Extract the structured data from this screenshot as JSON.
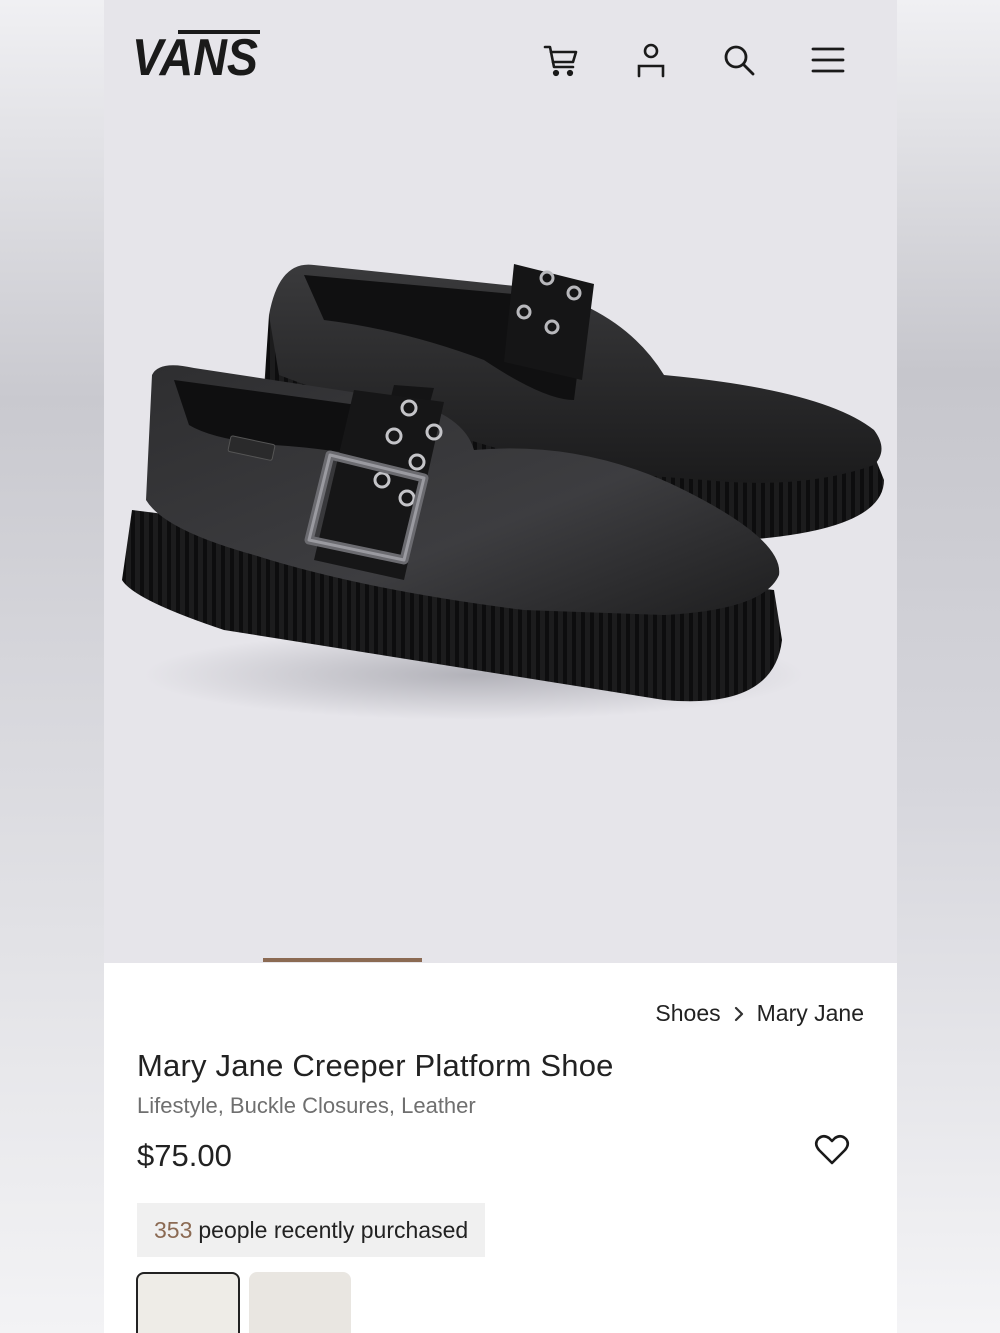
{
  "header": {
    "brand": "VANS",
    "icons": [
      "cart-icon",
      "account-icon",
      "search-icon",
      "menu-icon"
    ]
  },
  "gallery": {
    "image_alt": "Mary Jane Creeper Platform Shoe",
    "progress_fraction": 0.2
  },
  "breadcrumb": {
    "items": [
      "Shoes",
      "Mary Jane"
    ]
  },
  "product": {
    "title": "Mary Jane Creeper Platform Shoe",
    "subtitle": "Lifestyle, Buckle Closures, Leather",
    "price": "$75.00",
    "purchased_count": "353",
    "purchased_text": "people recently purchased"
  },
  "colors": {
    "accent": "#8b6a53",
    "text": "#222222",
    "muted": "#6f6f6f",
    "hero_bg": "#e6e5ea"
  }
}
